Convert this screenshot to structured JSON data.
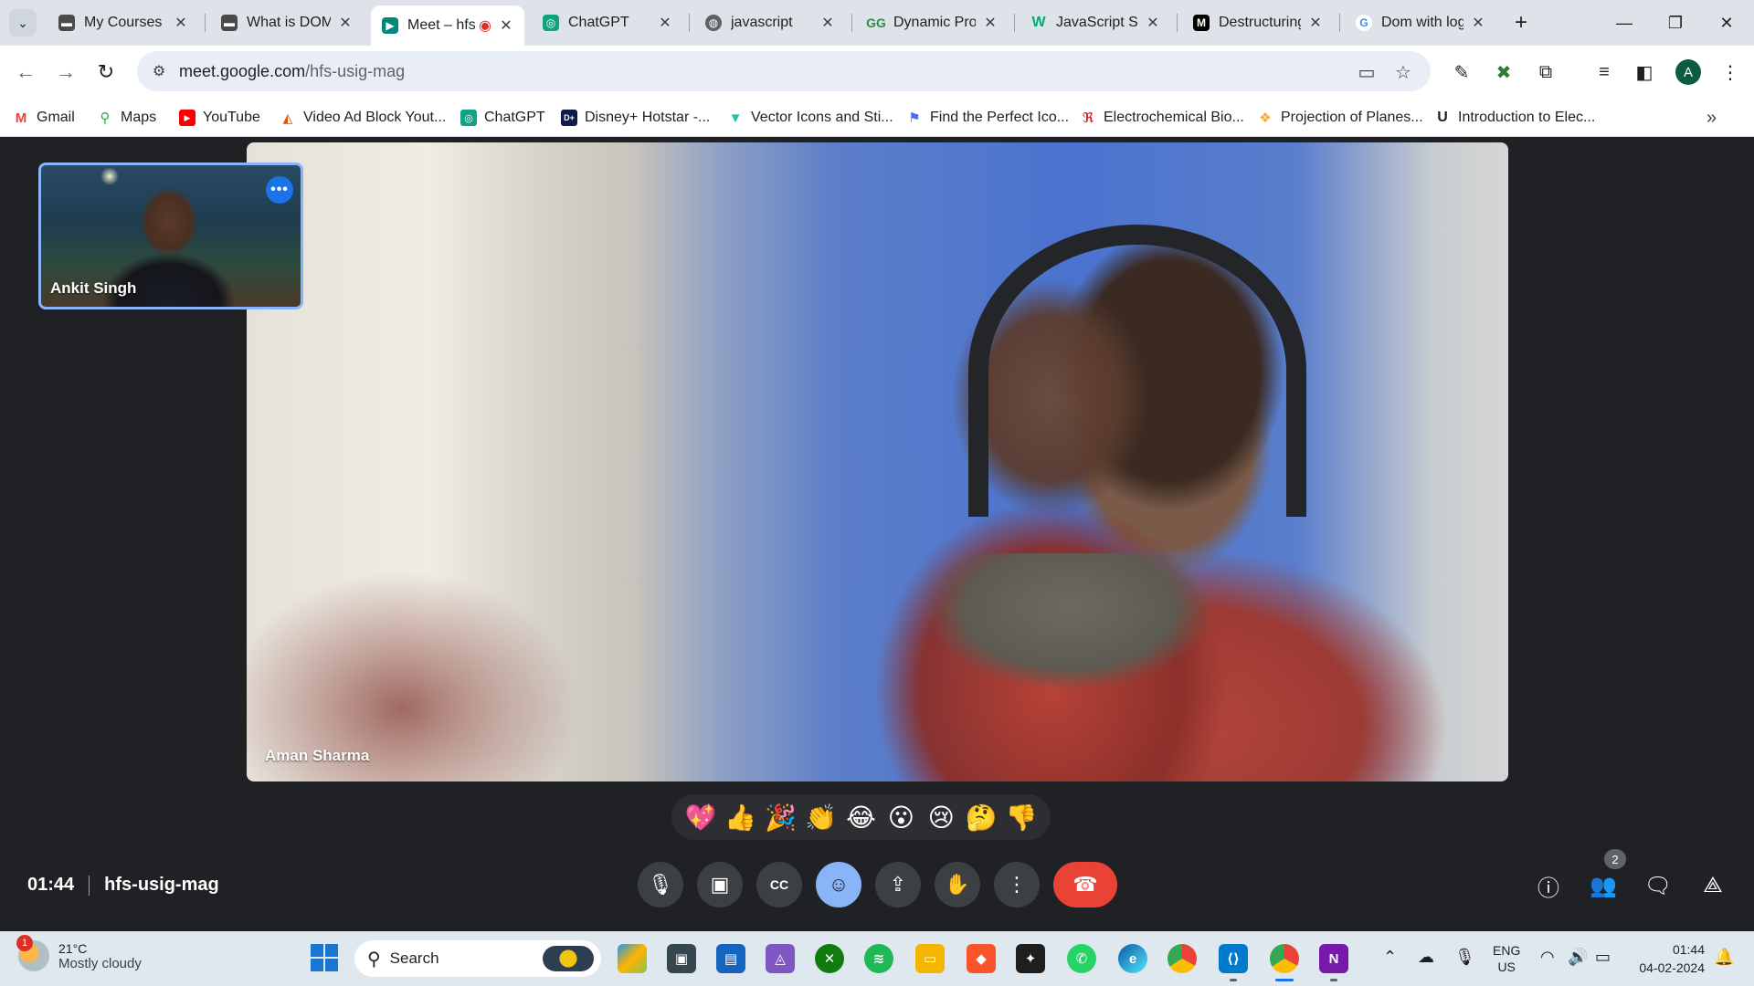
{
  "browser": {
    "tabs": [
      {
        "title": "My Courses",
        "favicon": "course-icon",
        "color": "#4a4a4a"
      },
      {
        "title": "What is DOM",
        "favicon": "course-icon",
        "color": "#4a4a4a"
      },
      {
        "title": "Meet – hfs-usig-mag",
        "favicon": "meet-icon",
        "color": "#00897b",
        "active": true
      },
      {
        "title": "ChatGPT",
        "favicon": "chatgpt-icon",
        "color": "#10a37f"
      },
      {
        "title": "javascript",
        "favicon": "globe-icon",
        "color": "#5f6368"
      },
      {
        "title": "Dynamic Programming",
        "favicon": "gfg-icon",
        "color": "#2f8d46"
      },
      {
        "title": "JavaScript String",
        "favicon": "w3-icon",
        "color": "#04aa6d"
      },
      {
        "title": "Destructuring assignment",
        "favicon": "mdn-icon",
        "color": "#000000"
      },
      {
        "title": "Dom with logic",
        "favicon": "google-icon",
        "color": "#4285f4"
      }
    ],
    "url_host": "meet.google.com",
    "url_path": "/hfs-usig-mag",
    "profile_initial": "A",
    "bookmarks": [
      {
        "label": "Gmail",
        "icon": "gmail-icon",
        "color": "#ea4335"
      },
      {
        "label": "Maps",
        "icon": "maps-icon",
        "color": "#34a853"
      },
      {
        "label": "YouTube",
        "icon": "youtube-icon",
        "color": "#ff0000"
      },
      {
        "label": "Video Ad Block Yout...",
        "icon": "adblock-icon",
        "color": "#e65100"
      },
      {
        "label": "ChatGPT",
        "icon": "chatgpt-icon",
        "color": "#10a37f"
      },
      {
        "label": "Disney+ Hotstar -...",
        "icon": "hotstar-icon",
        "color": "#0f1b4c"
      },
      {
        "label": "Vector Icons and Sti...",
        "icon": "flaticon-icon",
        "color": "#1bc5b4"
      },
      {
        "label": "Find the Perfect Ico...",
        "icon": "flag-icon",
        "color": "#4a6cf7"
      },
      {
        "label": "Electrochemical Bio...",
        "icon": "research-icon",
        "color": "#c62828"
      },
      {
        "label": "Projection of Planes...",
        "icon": "gift-icon",
        "color": "#f9a825"
      },
      {
        "label": "Introduction to Elec...",
        "icon": "u-icon",
        "color": "#1f1f1f"
      }
    ]
  },
  "meet": {
    "main_participant": "Aman Sharma",
    "self_participant": "Ankit Singh",
    "time": "01:44",
    "meeting_code": "hfs-usig-mag",
    "reactions": [
      "💖",
      "👍",
      "🎉",
      "👏",
      "😂",
      "😮",
      "😢",
      "🤔",
      "👎"
    ],
    "participant_count": "2"
  },
  "taskbar": {
    "weather_badge": "1",
    "temperature": "21°C",
    "condition": "Mostly cloudy",
    "search_placeholder": "Search",
    "lang_top": "ENG",
    "lang_bottom": "US",
    "time": "01:44",
    "date": "04-02-2024"
  }
}
